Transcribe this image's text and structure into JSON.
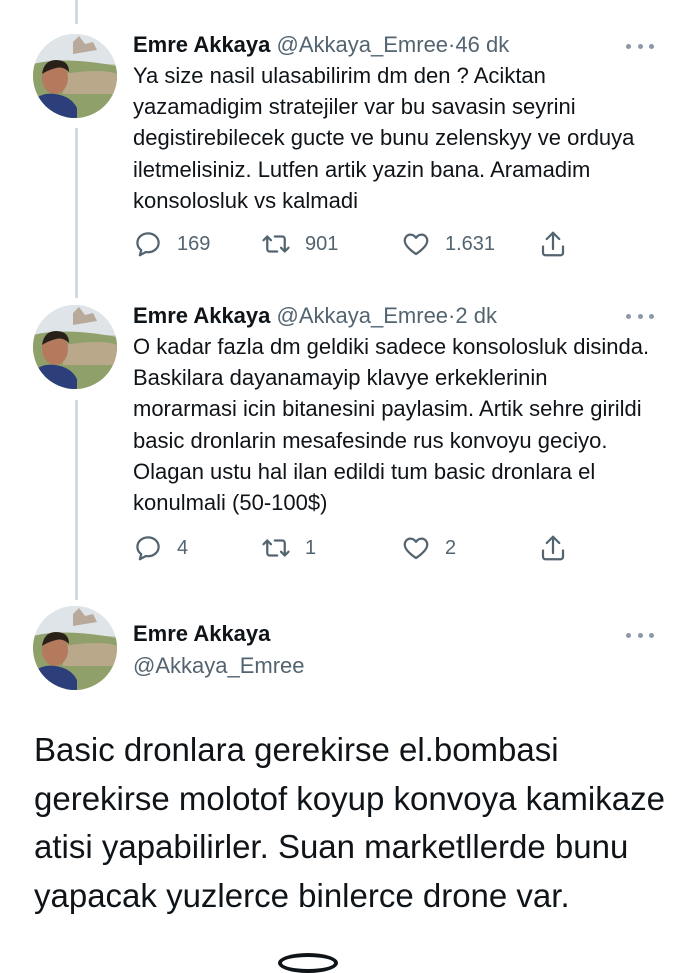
{
  "tweets": [
    {
      "name": "Emre Akkaya",
      "handle": "@Akkaya_Emree",
      "separator": "·",
      "time": "46 dk",
      "text": "Ya size nasil ulasabilirim dm den ? Aciktan yazamadigim stratejiler var bu savasin seyrini degistirebilecek gucte ve bunu zelenskyy ve orduya iletmelisiniz. Lutfen artik yazin bana. Aramadim konsolosluk vs kalmadi",
      "replies": "169",
      "retweets": "901",
      "likes": "1.631"
    },
    {
      "name": "Emre Akkaya",
      "handle": "@Akkaya_Emree",
      "separator": "·",
      "time": "2 dk",
      "text": "O kadar fazla dm geldiki sadece konsolosluk disinda. Baskilara dayanamayip klavye erkeklerinin morarmasi icin bitanesini paylasim. Artik sehre girildi basic dronlarin mesafesinde rus konvoyu geciyo. Olagan ustu hal ilan edildi tum basic dronlara el konulmali (50-100$)",
      "replies": "4",
      "retweets": "1",
      "likes": "2"
    }
  ],
  "main_tweet": {
    "name": "Emre Akkaya",
    "handle": "@Akkaya_Emree",
    "text": "Basic dronlara gerekirse el.bombasi gerekirse molotof koyup konvoya kamikaze atisi yapabilirler. Suan marketllerde bunu yapacak yuzlerce binlerce drone var."
  },
  "icons": {
    "reply": "reply-icon",
    "retweet": "retweet-icon",
    "like": "heart-icon",
    "share": "share-icon",
    "more": "more-icon"
  },
  "colors": {
    "text": "#0f1419",
    "secondary": "#536471",
    "thread_line": "#cfd9de"
  }
}
